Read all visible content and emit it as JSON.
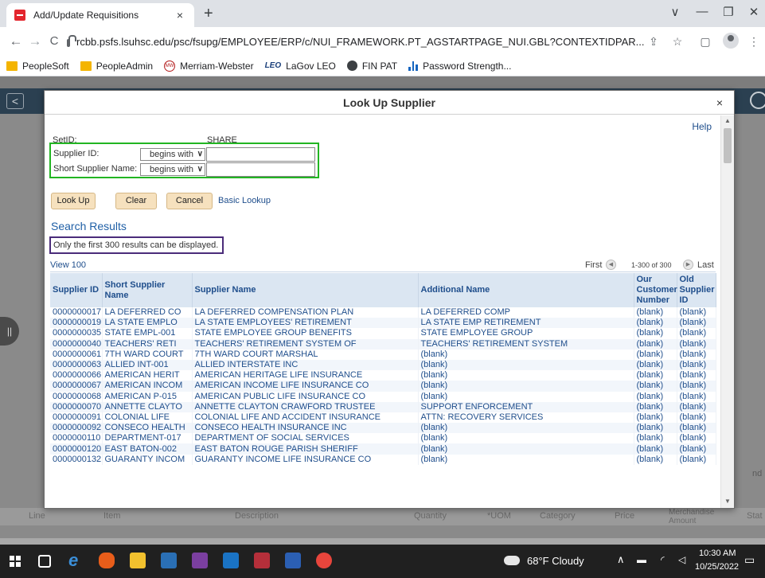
{
  "browser": {
    "tab_title": "Add/Update Requisitions",
    "tab_close": "×",
    "new_tab": "+",
    "url": "rcbb.psfs.lsuhsc.edu/psc/fsupg/EMPLOYEE/ERP/c/NUI_FRAMEWORK.PT_AGSTARTPAGE_NUI.GBL?CONTEXTIDPAR...",
    "window_controls": {
      "dropdown": "∨",
      "minimize": "—",
      "restore": "❐",
      "close": "✕"
    },
    "nav": {
      "back": "←",
      "forward": "→",
      "reload": "C"
    },
    "toolbar_icons": {
      "share": "⇪",
      "star": "☆",
      "panel": "▢",
      "menu": "⋮"
    },
    "bookmarks": [
      {
        "label": "PeopleSoft",
        "icon": "folder-icon"
      },
      {
        "label": "PeopleAdmin",
        "icon": "folder-icon"
      },
      {
        "label": "Merriam-Webster",
        "icon": "mw-icon"
      },
      {
        "label": "LaGov LEO",
        "icon": "lagov-icon"
      },
      {
        "label": "FIN PAT",
        "icon": "globe-icon"
      },
      {
        "label": "Password Strength...",
        "icon": "bars-icon"
      }
    ]
  },
  "background": {
    "back_arrow": "<",
    "handle": "||",
    "footer_columns": [
      "Line",
      "Item",
      "Description",
      "Quantity",
      "*UOM",
      "Category",
      "Price",
      "Merchandise Amount",
      "Stat"
    ],
    "right_peek": "nd"
  },
  "modal": {
    "title": "Look Up Supplier",
    "close": "×",
    "help": "Help",
    "setid_label": "SetID:",
    "setid_value": "SHARE",
    "supplier_id_label": "Supplier ID:",
    "supplier_id_operator": "begins with",
    "supplier_id_value": "",
    "short_name_label": "Short Supplier Name:",
    "short_name_operator": "begins with",
    "short_name_value": "",
    "buttons": {
      "lookup": "Look Up",
      "clear": "Clear",
      "cancel": "Cancel"
    },
    "basic_lookup": "Basic Lookup",
    "search_results_title": "Search Results",
    "limit_message": "Only the first 300 results can be displayed.",
    "grid": {
      "view": "View 100",
      "first": "First",
      "range": "1-300 of 300",
      "last": "Last",
      "prev_icon": "◀",
      "next_icon": "▶",
      "columns": [
        "Supplier ID",
        "Short Supplier Name",
        "Supplier Name",
        "Additional Name",
        "Our Customer Number",
        "Old Supplier ID"
      ],
      "rows": [
        [
          "0000000017",
          "LA DEFERRED CO",
          "LA DEFERRED COMPENSATION PLAN",
          "LA DEFERRED COMP",
          "(blank)",
          "(blank)"
        ],
        [
          "0000000019",
          "LA STATE EMPLO",
          "LA STATE EMPLOYEES' RETIREMENT",
          "LA STATE EMP RETIREMENT",
          "(blank)",
          "(blank)"
        ],
        [
          "0000000035",
          "STATE EMPL-001",
          "STATE EMPLOYEE GROUP BENEFITS",
          "STATE EMPLOYEE GROUP",
          "(blank)",
          "(blank)"
        ],
        [
          "0000000040",
          "TEACHERS' RETI",
          "TEACHERS' RETIREMENT SYSTEM OF",
          "TEACHERS' RETIREMENT SYSTEM",
          "(blank)",
          "(blank)"
        ],
        [
          "0000000061",
          "7TH WARD COURT",
          "7TH WARD COURT MARSHAL",
          "(blank)",
          "(blank)",
          "(blank)"
        ],
        [
          "0000000063",
          "ALLIED INT-001",
          "ALLIED INTERSTATE INC",
          "(blank)",
          "(blank)",
          "(blank)"
        ],
        [
          "0000000066",
          "AMERICAN HERIT",
          "AMERICAN HERITAGE LIFE INSURANCE",
          "(blank)",
          "(blank)",
          "(blank)"
        ],
        [
          "0000000067",
          "AMERICAN INCOM",
          "AMERICAN INCOME LIFE INSURANCE CO",
          "(blank)",
          "(blank)",
          "(blank)"
        ],
        [
          "0000000068",
          "AMERICAN P-015",
          "AMERICAN PUBLIC LIFE INSURANCE CO",
          "(blank)",
          "(blank)",
          "(blank)"
        ],
        [
          "0000000070",
          "ANNETTE CLAYTO",
          "ANNETTE CLAYTON CRAWFORD TRUSTEE",
          "SUPPORT ENFORCEMENT",
          "(blank)",
          "(blank)"
        ],
        [
          "0000000091",
          "COLONIAL LIFE",
          "COLONIAL LIFE AND ACCIDENT INSURANCE",
          "ATTN: RECOVERY SERVICES",
          "(blank)",
          "(blank)"
        ],
        [
          "0000000092",
          "CONSECO HEALTH",
          "CONSECO HEALTH INSURANCE INC",
          "(blank)",
          "(blank)",
          "(blank)"
        ],
        [
          "0000000110",
          "DEPARTMENT-017",
          "DEPARTMENT OF SOCIAL SERVICES",
          "(blank)",
          "(blank)",
          "(blank)"
        ],
        [
          "0000000120",
          "EAST BATON-002",
          "EAST BATON ROUGE PARISH SHERIFF",
          "(blank)",
          "(blank)",
          "(blank)"
        ],
        [
          "0000000132",
          "GUARANTY INCOM",
          "GUARANTY INCOME LIFE INSURANCE CO",
          "(blank)",
          "(blank)",
          "(blank)"
        ]
      ]
    }
  },
  "taskbar": {
    "weather": "68°F  Cloudy",
    "time": "10:30 AM",
    "date": "10/25/2022",
    "tray": "∧"
  },
  "colors": {
    "accent_link": "#1f4e8c",
    "green_highlight": "#22b522",
    "purple_highlight": "#4b2c7a",
    "button_bg": "#f6e1be"
  }
}
